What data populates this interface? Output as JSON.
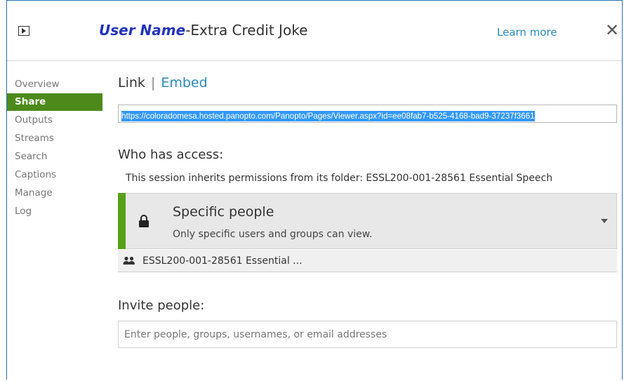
{
  "header": {
    "user_name": "User Name",
    "title_rest": "-Extra Credit Joke",
    "learn_more": "Learn more",
    "close": "✕"
  },
  "sidebar": {
    "items": [
      {
        "label": "Overview",
        "active": false
      },
      {
        "label": "Share",
        "active": true
      },
      {
        "label": "Outputs",
        "active": false
      },
      {
        "label": "Streams",
        "active": false
      },
      {
        "label": "Search",
        "active": false
      },
      {
        "label": "Captions",
        "active": false
      },
      {
        "label": "Manage",
        "active": false
      },
      {
        "label": "Log",
        "active": false
      }
    ]
  },
  "share": {
    "tab_link": "Link",
    "tab_separator": "|",
    "tab_embed": "Embed",
    "url": "https://coloradomesa.hosted.panopto.com/Panopto/Pages/Viewer.aspx?id=ee08fab7-b525-4168-bad9-37237f3661",
    "access_heading": "Who has access:",
    "inherit_text": "This session inherits permissions from its folder: ESSL200-001-28561 Essential Speech",
    "permission": {
      "title": "Specific people",
      "subtitle": "Only specific users and groups can view."
    },
    "group": "ESSL200-001-28561 Essential ...",
    "invite_heading": "Invite people:",
    "invite_placeholder": "Enter people, groups, usernames, or email addresses"
  },
  "colors": {
    "accent_green": "#4d8a1b",
    "permission_bar": "#57a11a",
    "link_blue": "#2a8ab8",
    "user_name_blue": "#2233bb",
    "url_highlight": "#3399ff"
  }
}
